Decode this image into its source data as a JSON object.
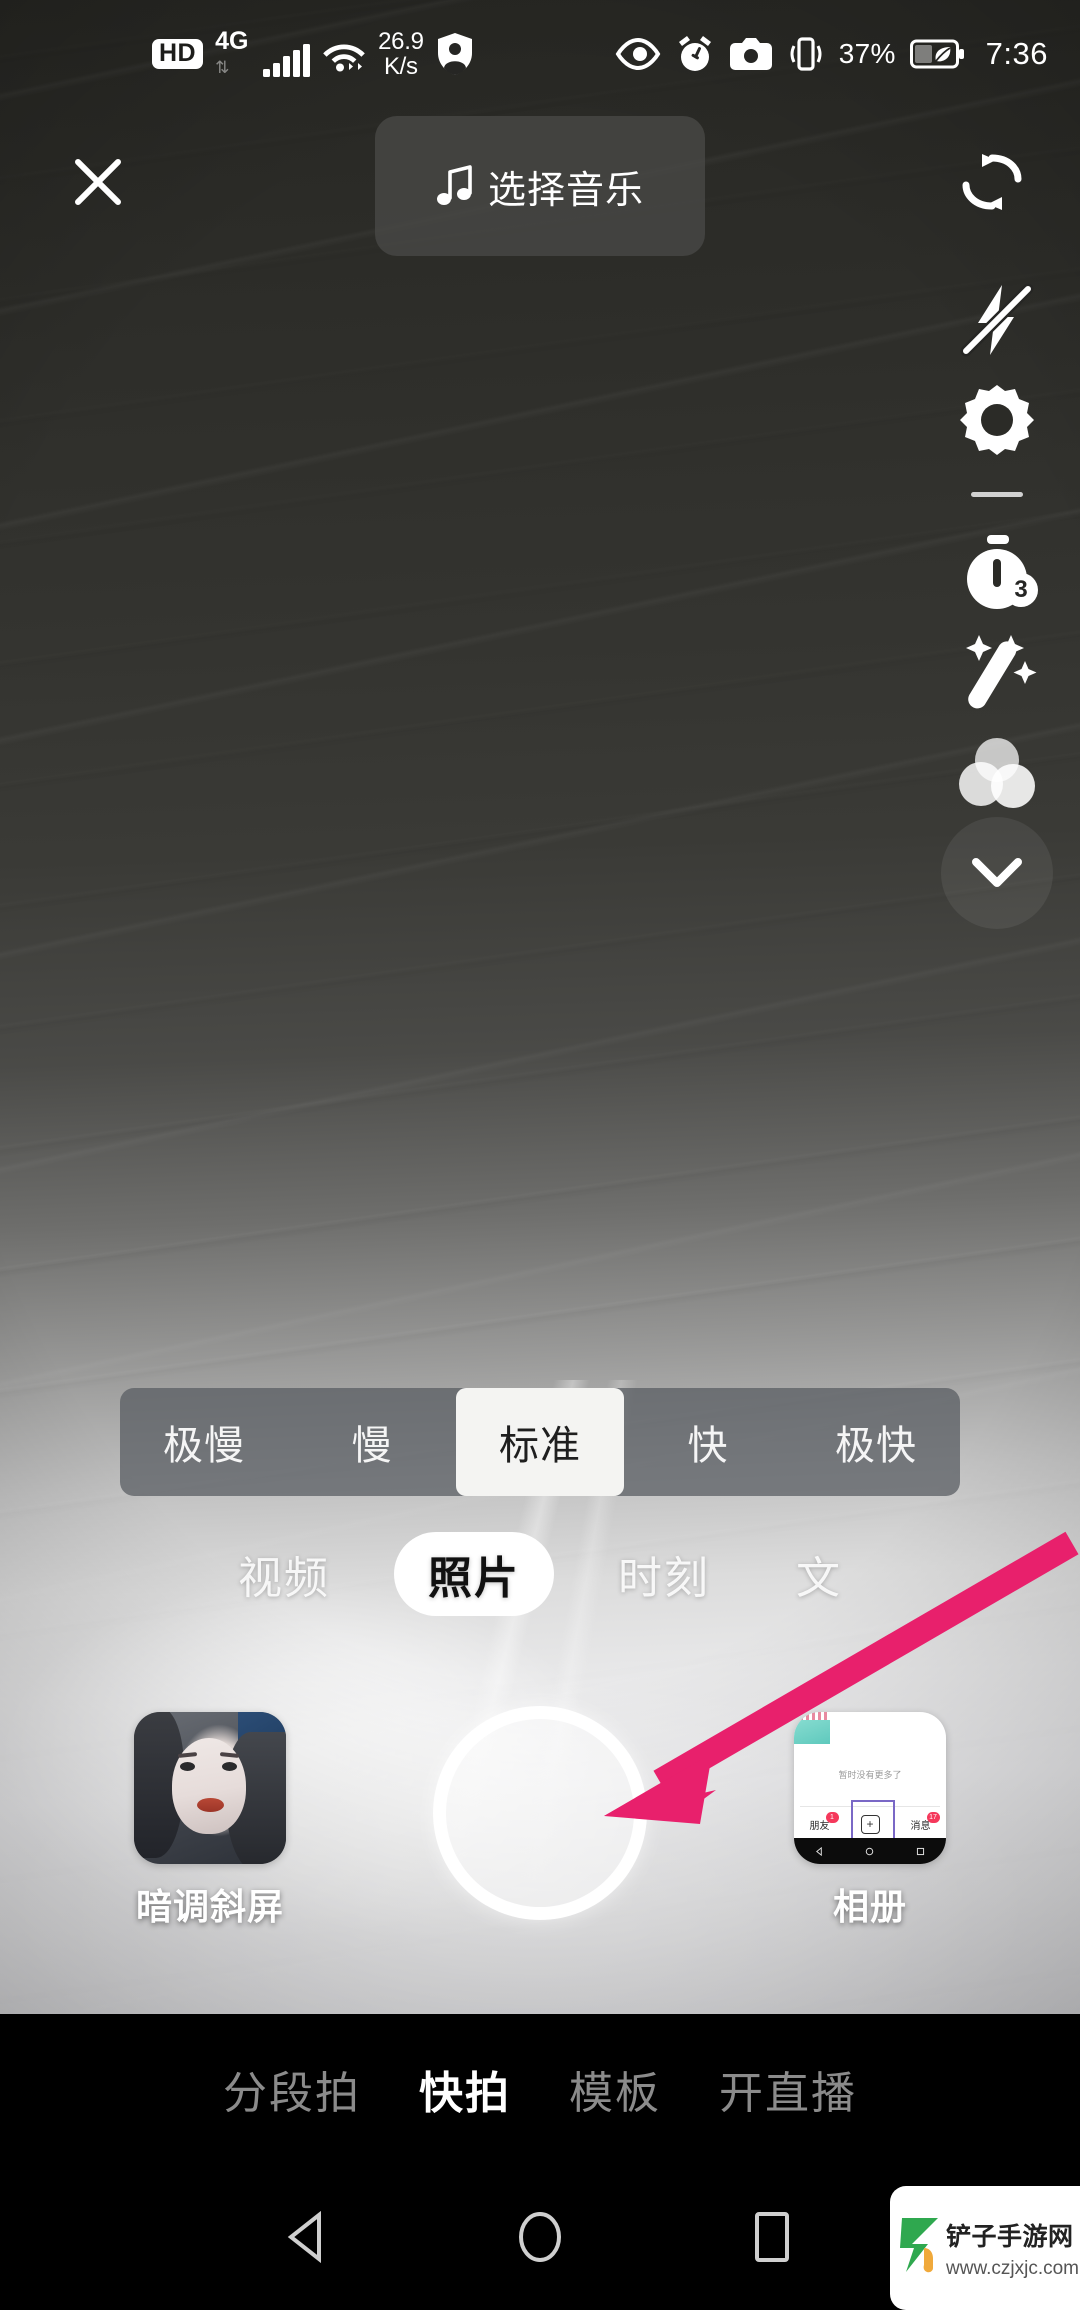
{
  "status_bar": {
    "hd_badge": "HD",
    "network_type": "4G",
    "data_speed_value": "26.9",
    "data_speed_unit": "K/s",
    "battery_percent": "37%",
    "time": "7:36",
    "icons_left": [
      "hd-badge",
      "signal-bars-icon",
      "wifi-icon",
      "data-speed-text",
      "privacy-shield-icon"
    ],
    "icons_right": [
      "eye-care-icon",
      "alarm-clock-icon",
      "screenshot-camera-icon",
      "vibrate-icon",
      "battery-saver-icon"
    ]
  },
  "top_bar": {
    "close_label": "✕",
    "music_label": "选择音乐",
    "music_icon": "music-note-icon",
    "flip_icon": "flip-camera-icon"
  },
  "right_tools": [
    {
      "name": "flash-off-icon",
      "label": "闪光灯关闭"
    },
    {
      "name": "settings-gear-icon",
      "label": "设置"
    },
    {
      "name": "timer-icon",
      "label": "倒计时",
      "badge": "3"
    },
    {
      "name": "beauty-wand-icon",
      "label": "美化"
    },
    {
      "name": "filter-circles-icon",
      "label": "滤镜"
    },
    {
      "name": "chevron-down-icon",
      "label": "展开更多"
    }
  ],
  "speed_bar": {
    "options": [
      "极慢",
      "慢",
      "标准",
      "快",
      "极快"
    ],
    "selected": "标准",
    "selected_index": 2
  },
  "mode_tabs": {
    "items": [
      "视频",
      "照片",
      "时刻",
      "文"
    ],
    "selected": "照片",
    "selected_index": 1
  },
  "capture_row": {
    "effect": {
      "label": "暗调斜屏",
      "thumb": "portrait-preset-thumbnail"
    },
    "shutter": {
      "name": "shutter-button"
    },
    "album": {
      "label": "相册",
      "thumb": "album-screenshot-thumbnail",
      "thumb_texts": {
        "no_more": "暂时没有更多了",
        "friends": "朋友",
        "friends_badge": "1",
        "plus": "+",
        "messages": "消息",
        "messages_badge": "17"
      }
    }
  },
  "bottom_nav": {
    "items": [
      "分段拍",
      "快拍",
      "模板",
      "开直播"
    ],
    "selected": "快拍",
    "selected_index": 1
  },
  "android_nav": {
    "back": "back-triangle-icon",
    "home": "home-circle-icon",
    "recents": "recents-square-icon"
  },
  "annotation": {
    "arrow_color": "#e8206c",
    "arrow_target": "shutter-button"
  },
  "watermark": {
    "name": "铲子手游网",
    "url": "www.czjxjc.com"
  }
}
